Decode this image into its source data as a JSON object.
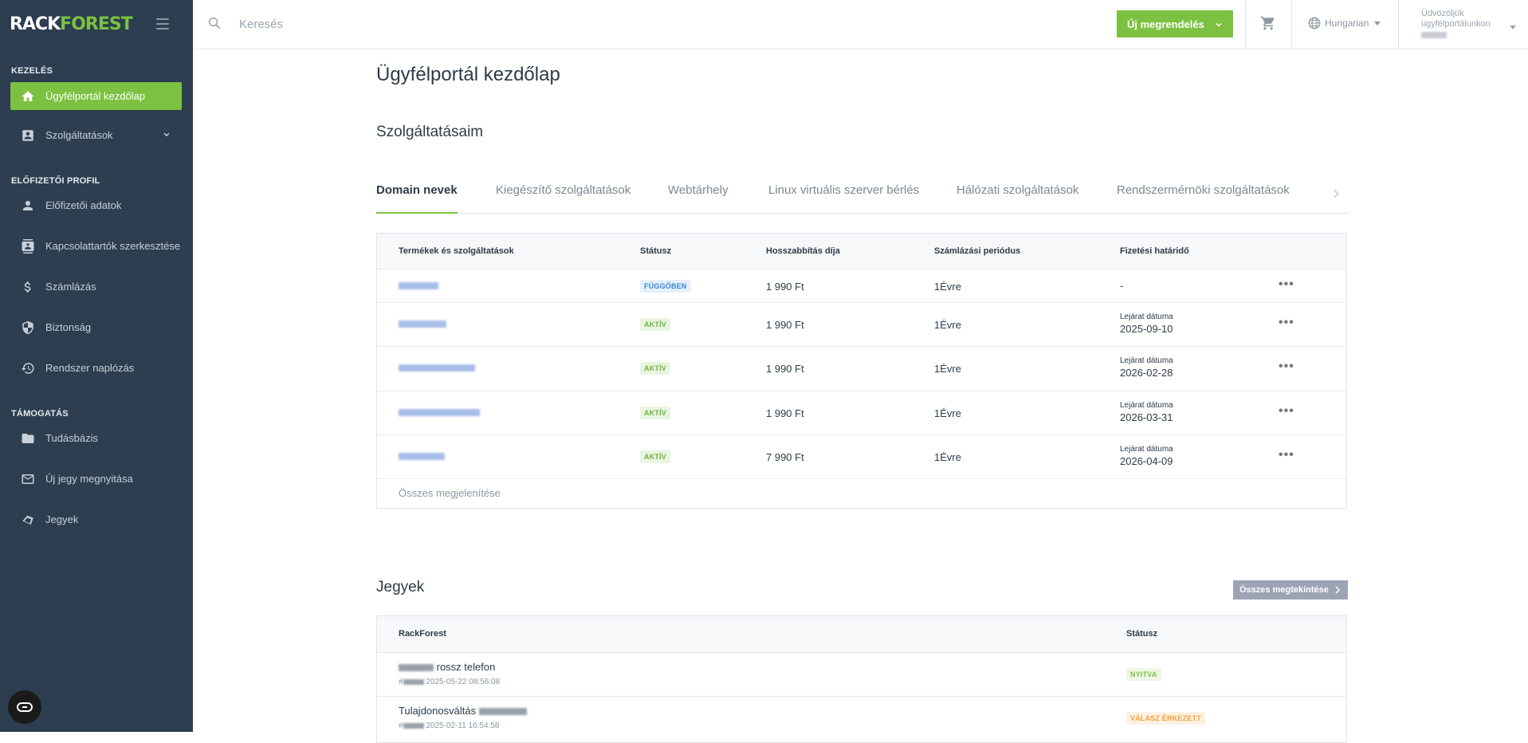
{
  "brand": {
    "logo_rack": "RACK",
    "logo_forest": "FOREST"
  },
  "sidebar": {
    "sections": [
      "KEZELÉS",
      "ELŐFIZETŐI PROFIL",
      "TÁMOGATÁS"
    ],
    "items": [
      {
        "label": "Ügyfélportál kezdőlap",
        "icon": "home-icon",
        "active": true
      },
      {
        "label": "Szolgáltatások",
        "icon": "services-icon"
      },
      {
        "label": "Előfizetői adatok",
        "icon": "user-icon"
      },
      {
        "label": "Kapcsolattartók szerkesztése",
        "icon": "contacts-icon"
      },
      {
        "label": "Számlázás",
        "icon": "dollar-icon"
      },
      {
        "label": "Biztonság",
        "icon": "shield-icon"
      },
      {
        "label": "Rendszer naplózás",
        "icon": "history-icon"
      },
      {
        "label": "Tudásbázis",
        "icon": "folder-icon"
      },
      {
        "label": "Új jegy megnyitása",
        "icon": "mail-icon"
      },
      {
        "label": "Jegyek",
        "icon": "tickets-icon"
      }
    ]
  },
  "topbar": {
    "search_placeholder": "Keresés",
    "new_order": "Új megrendelés",
    "language": "Hungarian",
    "welcome_line1": "Üdvözöljük",
    "welcome_line2": "ügyfélportálunkon"
  },
  "main": {
    "title": "Ügyfélportál kezdőlap",
    "services_heading": "Szolgáltatásaim",
    "tabs": [
      "Domain nevek",
      "Kiegészítő szolgáltatások",
      "Webtárhely",
      "Linux virtuális szerver bérlés",
      "Hálózati szolgáltatások",
      "Rendszermérnöki szolgáltatások"
    ],
    "services_table": {
      "headers": [
        "Termékek és szolgáltatások",
        "Státusz",
        "Hosszabbítás díja",
        "Számlázási periódus",
        "Fizetési határidő"
      ],
      "rows": [
        {
          "status": "FÜGGŐBEN",
          "price": "1 990 Ft",
          "period": "1Évre",
          "due_label": "",
          "due": "-"
        },
        {
          "status": "AKTÍV",
          "price": "1 990 Ft",
          "period": "1Évre",
          "due_label": "Lejárat dátuma",
          "due": "2025-09-10"
        },
        {
          "status": "AKTÍV",
          "price": "1 990 Ft",
          "period": "1Évre",
          "due_label": "Lejárat dátuma",
          "due": "2026-02-28"
        },
        {
          "status": "AKTÍV",
          "price": "1 990 Ft",
          "period": "1Évre",
          "due_label": "Lejárat dátuma",
          "due": "2026-03-31"
        },
        {
          "status": "AKTÍV",
          "price": "7 990 Ft",
          "period": "1Évre",
          "due_label": "Lejárat dátuma",
          "due": "2026-04-09"
        }
      ],
      "show_all": "Összes megjelenítése"
    },
    "tickets_heading": "Jegyek",
    "tickets_view_all": "Összes megtekintése",
    "tickets_table": {
      "headers": [
        "RackForest",
        "Státusz"
      ],
      "rows": [
        {
          "title": "rossz telefon",
          "id_prefix": "#",
          "date": "2025-05-22 08:56:08",
          "status": "NYITVA"
        },
        {
          "title": "Tulajdonosváltás",
          "id_prefix": "#",
          "date": "2025-02-11 16:54:58",
          "status": "VÁLASZ ÉRKEZETT"
        }
      ]
    }
  }
}
